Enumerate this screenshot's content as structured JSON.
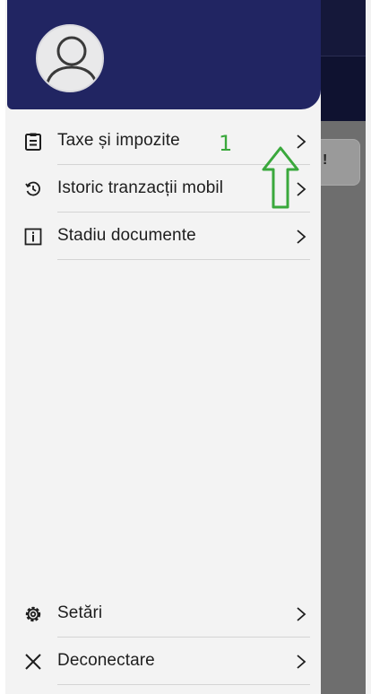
{
  "drawer": {
    "header": {
      "avatar": "user-avatar"
    },
    "menu_top": [
      {
        "label": "Taxe și impozite",
        "icon": "clipboard-icon"
      },
      {
        "label": "Istoric tranzacții mobil",
        "icon": "history-icon"
      },
      {
        "label": "Stadiu documente",
        "icon": "info-box-icon"
      }
    ],
    "menu_bottom": [
      {
        "label": "Setări",
        "icon": "gear-icon"
      },
      {
        "label": "Deconectare",
        "icon": "close-icon"
      }
    ]
  },
  "background_app": {
    "card_text": "!"
  },
  "annotation": {
    "number": "1",
    "color": "#3aa83c"
  },
  "colors": {
    "header": "#212562",
    "drawer_bg": "#f3f3f3",
    "overlay": "#6e6e6e"
  }
}
